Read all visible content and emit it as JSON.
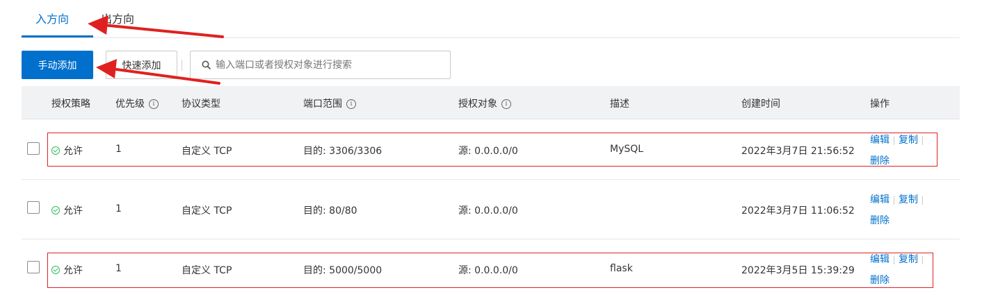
{
  "tabs": [
    {
      "label": "入方向",
      "active": true
    },
    {
      "label": "出方向",
      "active": false
    }
  ],
  "toolbar": {
    "manual_add_label": "手动添加",
    "quick_add_label": "快速添加",
    "search_placeholder": "输入端口或者授权对象进行搜索",
    "search_value": ""
  },
  "table": {
    "columns": [
      "授权策略",
      "优先级",
      "协议类型",
      "端口范围",
      "授权对象",
      "描述",
      "创建时间",
      "操作"
    ],
    "info_icon_glyph": "i",
    "rows": [
      {
        "policy": "允许",
        "priority": "1",
        "protocol": "自定义 TCP",
        "port_range": "目的: 3306/3306",
        "auth_object": "源: 0.0.0.0/0",
        "description": "MySQL",
        "created": "2022年3月7日 21:56:52"
      },
      {
        "policy": "允许",
        "priority": "1",
        "protocol": "自定义 TCP",
        "port_range": "目的: 80/80",
        "auth_object": "源: 0.0.0.0/0",
        "description": "",
        "created": "2022年3月7日 11:06:52"
      },
      {
        "policy": "允许",
        "priority": "1",
        "protocol": "自定义 TCP",
        "port_range": "目的: 5000/5000",
        "auth_object": "源: 0.0.0.0/0",
        "description": "flask",
        "created": "2022年3月5日 15:39:29"
      }
    ],
    "actions": {
      "edit": "编辑",
      "copy": "复制",
      "delete": "删除",
      "separator": "|"
    }
  },
  "colors": {
    "accent": "#0070cc",
    "annotation_red": "#e02020",
    "success_green": "#2bbc5a"
  }
}
